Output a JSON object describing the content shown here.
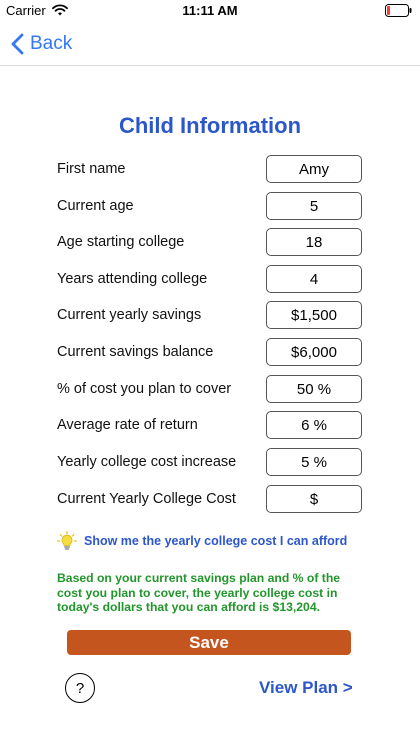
{
  "status_bar": {
    "carrier": "Carrier",
    "time": "11:11 AM",
    "battery_color": "#ff3b30"
  },
  "nav": {
    "back_label": "Back",
    "accent_color": "#3478f6"
  },
  "page": {
    "title": "Child Information",
    "title_color": "#2c57c9"
  },
  "form": {
    "fields": [
      {
        "label": "First name",
        "value": "Amy"
      },
      {
        "label": "Current age",
        "value": "5"
      },
      {
        "label": "Age starting college",
        "value": "18"
      },
      {
        "label": "Years attending college",
        "value": "4"
      },
      {
        "label": "Current yearly savings",
        "value": "$1,500"
      },
      {
        "label": "Current savings balance",
        "value": "$6,000"
      },
      {
        "label": "% of cost you plan to cover",
        "value": "50 %"
      },
      {
        "label": "Average rate of return",
        "value": "6 %"
      },
      {
        "label": "Yearly college cost increase",
        "value": "5 %"
      },
      {
        "label": "Current Yearly College Cost",
        "value": "$"
      }
    ]
  },
  "afford": {
    "icon": "lightbulb-icon",
    "text": "Show me the yearly college cost I can afford"
  },
  "info": {
    "text": "Based on your current savings plan and % of the cost you plan to cover, the yearly college cost in today's dollars that you can afford is $13,204.",
    "color": "#22962c"
  },
  "actions": {
    "save_label": "Save",
    "save_color": "#c4551f",
    "help_label": "?",
    "view_plan_label": "View Plan >"
  }
}
